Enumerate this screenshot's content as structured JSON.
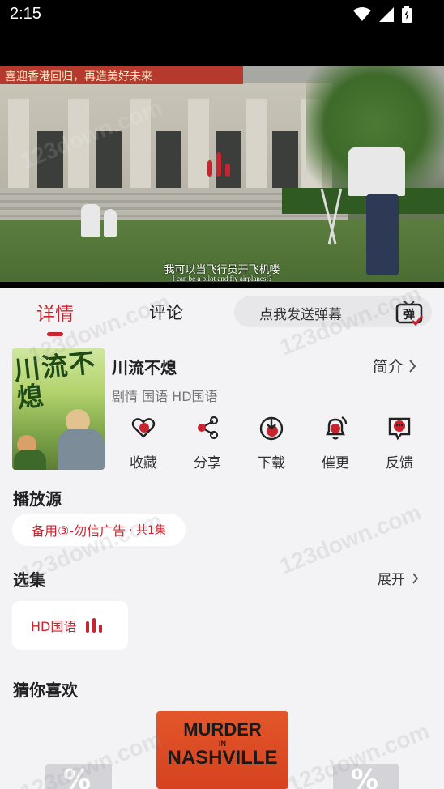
{
  "status_bar": {
    "time": "2:15"
  },
  "player": {
    "banner_text": "喜迎香港回归，再造美好未来",
    "subtitle_cn": "我可以当飞行员开飞机喽",
    "subtitle_en": "I can be a pilot and fly airplanes!?"
  },
  "tabs": [
    {
      "label": "详情",
      "active": true
    },
    {
      "label": "评论",
      "active": false
    }
  ],
  "danmaku": {
    "placeholder": "点我发送弹幕",
    "icon_char": "弹"
  },
  "movie": {
    "poster_text": "川流不熄",
    "title": "川流不熄",
    "meta": "剧情 国语 HD国语",
    "intro_label": "简介"
  },
  "actions": [
    {
      "label": "收藏",
      "icon": "heart-icon"
    },
    {
      "label": "分享",
      "icon": "share-icon"
    },
    {
      "label": "下载",
      "icon": "download-icon"
    },
    {
      "label": "催更",
      "icon": "bell-icon"
    },
    {
      "label": "反馈",
      "icon": "feedback-icon"
    }
  ],
  "sources": {
    "title": "播放源",
    "selected": {
      "name": "备用③-勿信广告",
      "count": "· 共1集"
    }
  },
  "episodes": {
    "title": "选集",
    "expand_label": "展开",
    "items": [
      {
        "label": "HD国语"
      }
    ]
  },
  "recommend": {
    "title": "猜你喜欢",
    "cards": [
      {
        "line1": "MURDER",
        "line2": "IN",
        "line3": "NASHVILLE"
      }
    ],
    "placeholder_glyph": "%"
  },
  "watermark": "123down.com",
  "colors": {
    "accent": "#c8242f",
    "background": "#f3f3f5"
  }
}
